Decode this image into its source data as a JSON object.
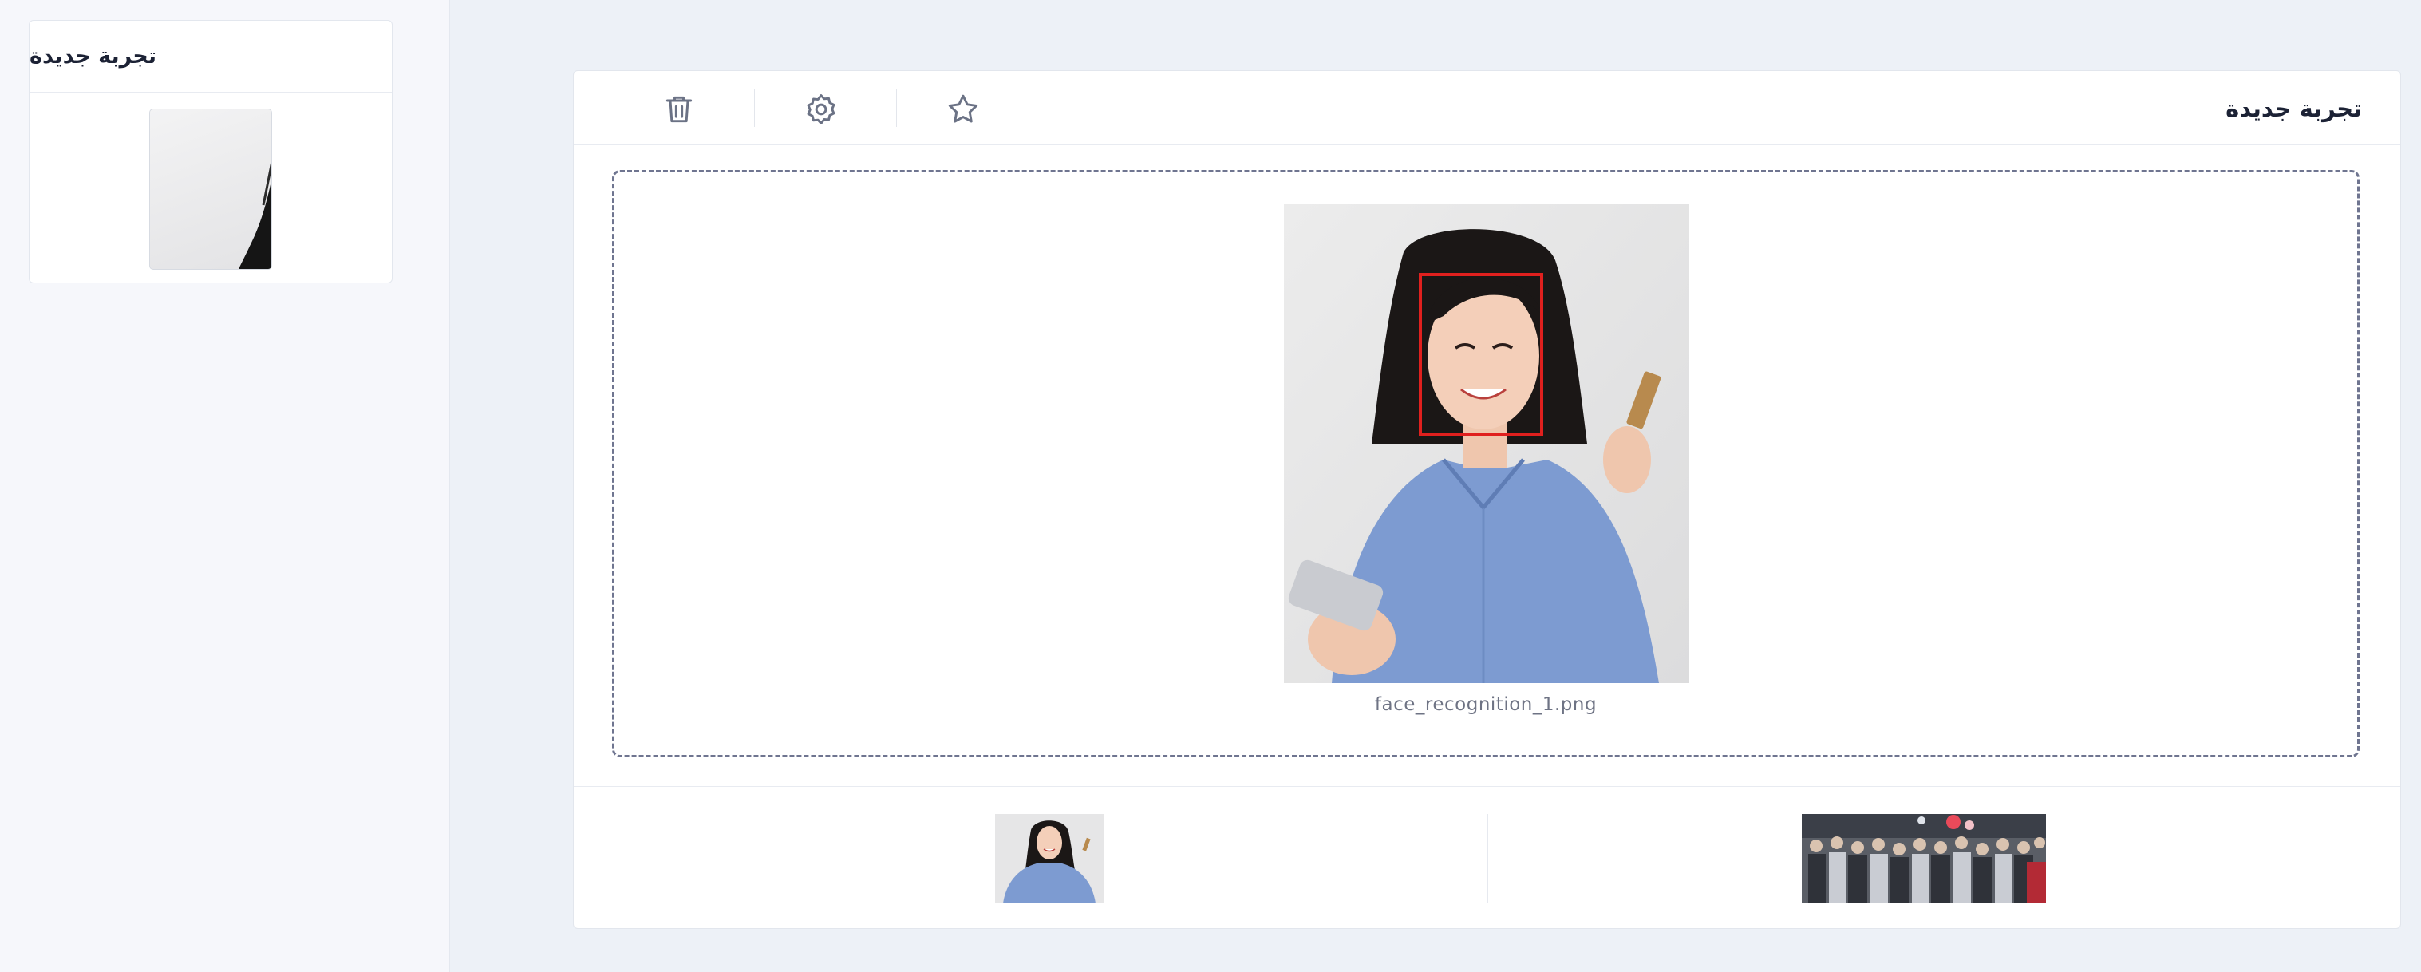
{
  "sidebar": {
    "history": [
      {
        "title": "تجربة جديدة",
        "thumbnail": "portrait-photo-crop"
      }
    ]
  },
  "main": {
    "title": "تجربة جديدة",
    "toolbar": {
      "icons": [
        "trash-icon",
        "gear-icon",
        "star-icon"
      ]
    },
    "image": {
      "filename": "face_recognition_1.png",
      "detection_color": "#e0201e"
    },
    "samples": [
      {
        "kind": "portrait-photo"
      },
      {
        "kind": "crowd-photo"
      }
    ]
  },
  "colors": {
    "page_background": "#edf1f7",
    "sidebar_background": "#f6f7fb",
    "icon_color": "#6b7285",
    "dropzone_border": "#6f7590"
  }
}
